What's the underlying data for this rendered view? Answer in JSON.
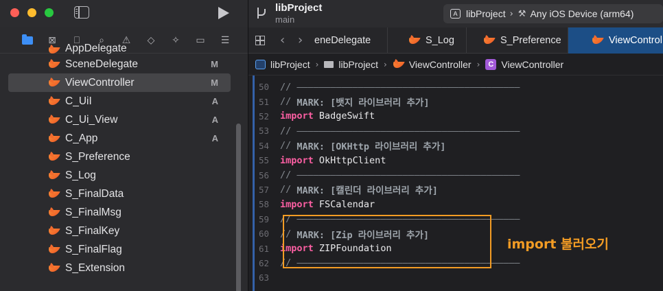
{
  "window": {
    "project_name": "libProject",
    "branch": "main",
    "scheme": {
      "project": "libProject",
      "chevron": "›",
      "destination": "Any iOS Device (arm64)"
    }
  },
  "navigator": {
    "files": [
      {
        "name": "AppDelegate",
        "status": ""
      },
      {
        "name": "SceneDelegate",
        "status": "M"
      },
      {
        "name": "ViewController",
        "status": "M",
        "selected": true
      },
      {
        "name": "C_UiI",
        "status": "A"
      },
      {
        "name": "C_Ui_View",
        "status": "A"
      },
      {
        "name": "C_App",
        "status": "A"
      },
      {
        "name": "S_Preference",
        "status": ""
      },
      {
        "name": "S_Log",
        "status": ""
      },
      {
        "name": "S_FinalData",
        "status": ""
      },
      {
        "name": "S_FinalMsg",
        "status": ""
      },
      {
        "name": "S_FinalKey",
        "status": ""
      },
      {
        "name": "S_FinalFlag",
        "status": ""
      },
      {
        "name": "S_Extension",
        "status": ""
      }
    ],
    "toolbar_icons": [
      "folder-icon",
      "source-control-icon",
      "bookmark-icon",
      "search-icon",
      "warning-icon",
      "test-icon",
      "debug-icon",
      "breakpoint-icon",
      "report-icon"
    ]
  },
  "tabs": [
    {
      "label": "eneDelegate"
    },
    {
      "label": "S_Log"
    },
    {
      "label": "S_Preference"
    },
    {
      "label": "ViewControl",
      "active": true
    }
  ],
  "jumpbar": {
    "project": "libProject",
    "folder": "libProject",
    "file": "ViewController",
    "class": "ViewController",
    "class_badge": "C",
    "chevron": "›"
  },
  "code": {
    "lines": [
      {
        "num": "50",
        "comment": "// ————————————————————————————————————————"
      },
      {
        "num": "51",
        "comment": "// ",
        "mark": "MARK: [뱃지 라이브러리 추가]"
      },
      {
        "num": "52",
        "kw": "import",
        "id": " BadgeSwift"
      },
      {
        "num": "53",
        "comment": "// ————————————————————————————————————————"
      },
      {
        "num": "54",
        "comment": "// ",
        "mark": "MARK: [OKHttp 라이브러리 추가]"
      },
      {
        "num": "55",
        "kw": "import",
        "id": " OkHttpClient"
      },
      {
        "num": "56",
        "comment": "// ————————————————————————————————————————"
      },
      {
        "num": "57",
        "comment": "// ",
        "mark": "MARK: [캘린더 라이브러리 추가]"
      },
      {
        "num": "58",
        "kw": "import",
        "id": " FSCalendar"
      },
      {
        "num": "59",
        "comment": "// ————————————————————————————————————————"
      },
      {
        "num": "60",
        "comment": "// ",
        "mark": "MARK: [Zip 라이브러리 추가]"
      },
      {
        "num": "61",
        "kw": "import",
        "id": " ZIPFoundation"
      },
      {
        "num": "62",
        "comment": "// ————————————————————————————————————————"
      },
      {
        "num": "63",
        "comment": ""
      }
    ]
  },
  "annotation": {
    "text": "import 불러오기",
    "color": "#f39c24"
  },
  "colors": {
    "keyword": "#fc5fa3",
    "comment": "#84898f",
    "active_tab": "#1c4e86",
    "swift": "#f26b2e"
  }
}
